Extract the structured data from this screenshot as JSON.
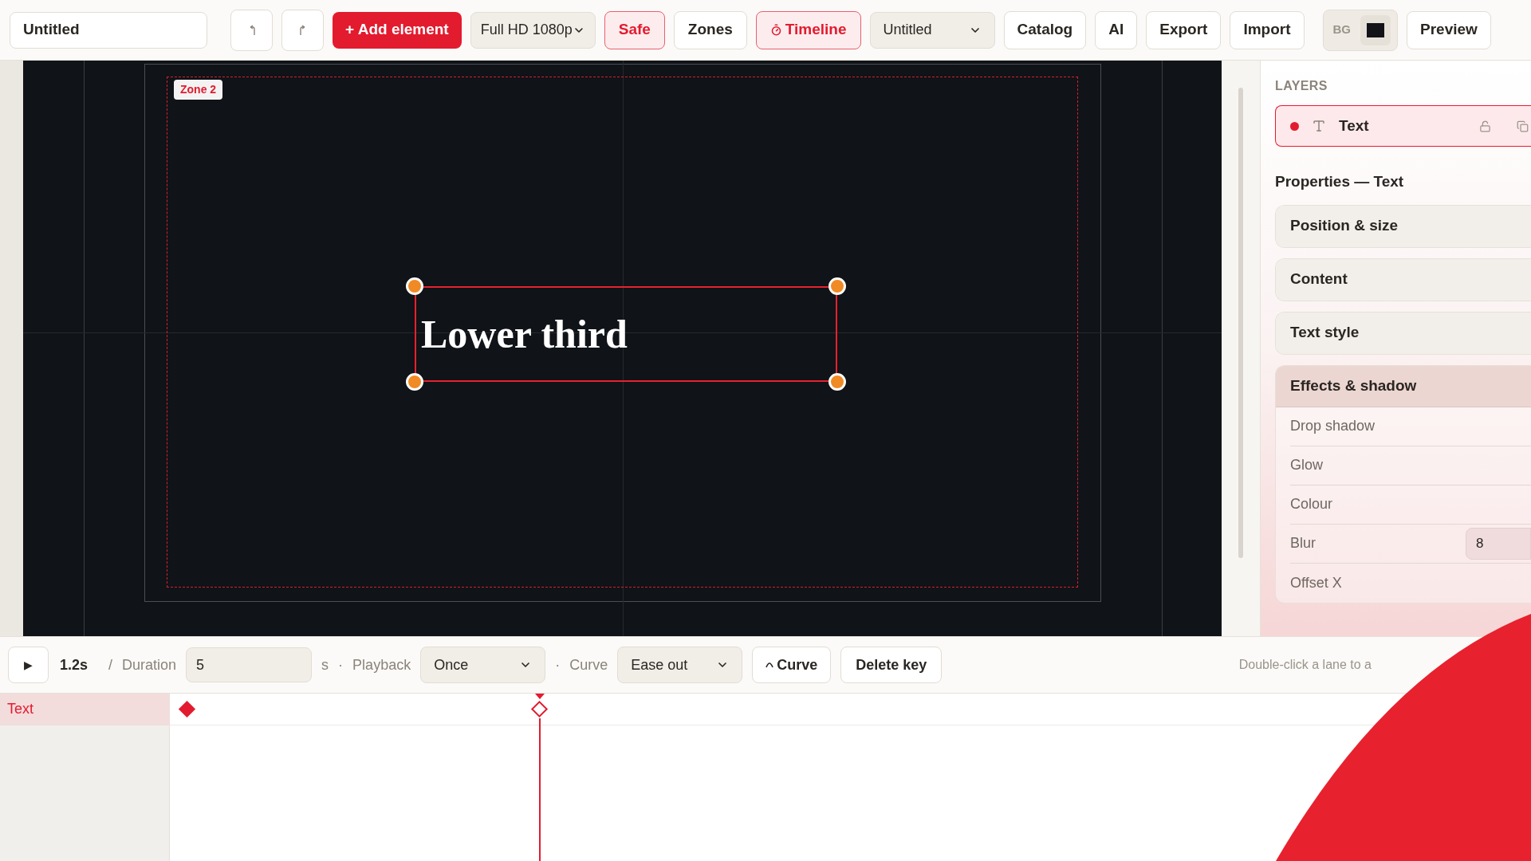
{
  "toolbar": {
    "project_name": "Untitled",
    "add_button": "+ Add element",
    "resolution": "Full HD 1080p",
    "toggles": [
      {
        "label": "Safe",
        "kind": "plain",
        "on": true
      },
      {
        "label": "Zones",
        "kind": "plain",
        "on": false
      },
      {
        "label": "Timeline",
        "kind": "timer",
        "on": true
      }
    ],
    "template": "Untitled",
    "buttons": [
      "Catalog",
      "AI",
      "Export",
      "Import"
    ],
    "bg_label": "BG",
    "preview": "Preview"
  },
  "canvas": {
    "zone_label": "Zone 2",
    "element_text": "Lower third",
    "selected": true
  },
  "layers": {
    "heading": "LAYERS",
    "items": [
      {
        "name": "Text",
        "selected": true
      }
    ]
  },
  "properties": {
    "heading": "Properties — Text",
    "sections": [
      {
        "title": "Position & size",
        "expanded": false
      },
      {
        "title": "Content",
        "expanded": false
      },
      {
        "title": "Text style",
        "expanded": false
      },
      {
        "title": "Effects & shadow",
        "expanded": true,
        "rows": [
          {
            "label": "Drop shadow"
          },
          {
            "label": "Glow"
          },
          {
            "label": "Colour"
          },
          {
            "label": "Blur",
            "value": "8"
          },
          {
            "label": "Offset X"
          }
        ]
      }
    ]
  },
  "timeline": {
    "play": "▶",
    "time": "1.2s",
    "slash": "/",
    "duration_label": "Duration",
    "duration": "5",
    "unit": "s",
    "dot1": "·",
    "playback_label": "Playback",
    "playback": "Once",
    "dot2": "·",
    "curve_label": "Curve",
    "curve": "Ease out",
    "curve_button": "Curve",
    "delete_button": "Delete key",
    "hint": "Double-click a lane to a",
    "tracks": [
      {
        "name": "Text",
        "selected": true,
        "keyframes": [
          {
            "at_playhead": false
          },
          {
            "at_playhead": true
          }
        ]
      }
    ]
  }
}
